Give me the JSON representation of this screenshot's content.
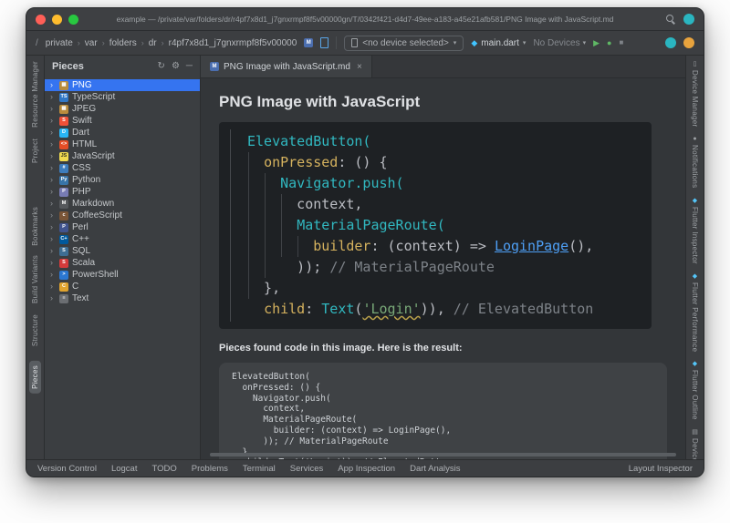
{
  "colors": {
    "plain": "#bcbec4",
    "teal": "#31b8c0",
    "yellow": "#d5b25e",
    "comment": "#7d8288",
    "string": "#79a978",
    "link": "#4e9ff5",
    "accent": "#3574f0"
  },
  "icons": {
    "root_slash": "/",
    "markdown": "M",
    "refresh": "↻",
    "gear": "⚙",
    "hide": "─",
    "close": "×",
    "chevron_down": "▾",
    "play": "▶",
    "debug": "●",
    "stop": "■",
    "dart": "◆"
  },
  "titlebar": {
    "title": "example — /private/var/folders/dr/r4pf7x8d1_j7gnxrmpf8f5v00000gn/T/0342f421-d4d7-49ee-a183-a45e21afb581/PNG Image with JavaScript.md"
  },
  "toolbar": {
    "breadcrumbs": [
      "private",
      "var",
      "folders",
      "dr",
      "r4pf7x8d1_j7gnxrmpf8f5v00000"
    ],
    "device_selector": "<no device selected>",
    "run_config": "main.dart",
    "devices_label": "No Devices"
  },
  "left_stripe": [
    {
      "label": "Resource Manager"
    },
    {
      "label": "Project"
    },
    {
      "label": "Bookmarks"
    },
    {
      "label": "Build Variants"
    },
    {
      "label": "Structure"
    },
    {
      "label": "Pieces",
      "active": true
    }
  ],
  "right_stripe": [
    {
      "label": "Device Manager",
      "icon": "phone-icon",
      "glyph": "▯"
    },
    {
      "label": "Notifications",
      "icon": "bell-icon",
      "glyph": "●"
    },
    {
      "label": "Flutter Inspector",
      "icon": "flutter-icon",
      "glyph": "◆"
    },
    {
      "label": "Flutter Performance",
      "icon": "flutter-icon",
      "glyph": "◆"
    },
    {
      "label": "Flutter Outline",
      "icon": "flutter-icon",
      "glyph": "◆"
    },
    {
      "label": "Device Fi",
      "icon": "folder-icon",
      "glyph": "▤"
    }
  ],
  "pieces_panel": {
    "title": "Pieces",
    "items": [
      {
        "label": "PNG",
        "icon": "image-icon",
        "icon_color": "#b98c3d",
        "glyph": "▦",
        "selected": true
      },
      {
        "label": "TypeScript",
        "icon": "typescript-icon",
        "icon_color": "#3178c6",
        "glyph": "TS"
      },
      {
        "label": "JPEG",
        "icon": "image-icon",
        "icon_color": "#b98c3d",
        "glyph": "▦"
      },
      {
        "label": "Swift",
        "icon": "swift-icon",
        "icon_color": "#f05138",
        "glyph": "S"
      },
      {
        "label": "Dart",
        "icon": "dart-icon",
        "icon_color": "#29b6f6",
        "glyph": "D"
      },
      {
        "label": "HTML",
        "icon": "html-icon",
        "icon_color": "#e44d26",
        "glyph": "<>"
      },
      {
        "label": "JavaScript",
        "icon": "javascript-icon",
        "icon_color": "#f0db4f",
        "glyph": "JS",
        "glyph_color": "#33331f"
      },
      {
        "label": "CSS",
        "icon": "css-icon",
        "icon_color": "#3d7dbd",
        "glyph": "#"
      },
      {
        "label": "Python",
        "icon": "python-icon",
        "icon_color": "#3874a8",
        "glyph": "Py"
      },
      {
        "label": "PHP",
        "icon": "php-icon",
        "icon_color": "#777bb4",
        "glyph": "P"
      },
      {
        "label": "Markdown",
        "icon": "markdown-icon",
        "icon_color": "#55585c",
        "glyph": "M"
      },
      {
        "label": "CoffeeScript",
        "icon": "coffeescript-icon",
        "icon_color": "#7a5537",
        "glyph": "c"
      },
      {
        "label": "Perl",
        "icon": "perl-icon",
        "icon_color": "#41548f",
        "glyph": "P"
      },
      {
        "label": "C++",
        "icon": "cpp-icon",
        "icon_color": "#00599c",
        "glyph": "C+"
      },
      {
        "label": "SQL",
        "icon": "sql-icon",
        "icon_color": "#3e6e93",
        "glyph": "S"
      },
      {
        "label": "Scala",
        "icon": "scala-icon",
        "icon_color": "#d43b3b",
        "glyph": "S"
      },
      {
        "label": "PowerShell",
        "icon": "powershell-icon",
        "icon_color": "#2b77d1",
        "glyph": ">"
      },
      {
        "label": "C",
        "icon": "c-icon",
        "icon_color": "#e0a32e",
        "glyph": "C"
      },
      {
        "label": "Text",
        "icon": "text-icon",
        "icon_color": "#6b6e72",
        "glyph": "≡"
      }
    ]
  },
  "editor": {
    "tab_label": "PNG Image with JavaScript.md",
    "heading": "PNG Image with JavaScript",
    "caption": "Pieces found code in this image. Here is the result:",
    "image_code": [
      [
        {
          "t": "ElevatedButton(",
          "c": "teal"
        }
      ],
      [
        {
          "t": "  "
        },
        {
          "t": "onPressed",
          "c": "yellow"
        },
        {
          "t": ": () {"
        }
      ],
      [
        {
          "t": "    "
        },
        {
          "t": "Navigator.push(",
          "c": "teal"
        }
      ],
      [
        {
          "t": "      context,"
        }
      ],
      [
        {
          "t": "      "
        },
        {
          "t": "MaterialPageRoute(",
          "c": "teal"
        }
      ],
      [
        {
          "t": "        "
        },
        {
          "t": "builder",
          "c": "yellow"
        },
        {
          "t": ": (context) => "
        },
        {
          "t": "LoginPage",
          "c": "link",
          "u": true
        },
        {
          "t": "(),"
        }
      ],
      [
        {
          "t": "      )); "
        },
        {
          "t": "// MaterialPageRoute",
          "c": "comment"
        }
      ],
      [
        {
          "t": "  },"
        }
      ],
      [
        {
          "t": "  "
        },
        {
          "t": "child",
          "c": "yellow"
        },
        {
          "t": ": "
        },
        {
          "t": "Text",
          "c": "teal"
        },
        {
          "t": "("
        },
        {
          "t": "'Login'",
          "c": "string",
          "w": true
        },
        {
          "t": ")), "
        },
        {
          "t": "// ElevatedButton",
          "c": "comment"
        }
      ]
    ],
    "result_code": [
      "ElevatedButton(",
      "  onPressed: () {",
      "    Navigator.push(",
      "      context,",
      "      MaterialPageRoute(",
      "        builder: (context) => LoginPage(),",
      "      )); // MaterialPageRoute",
      "  },",
      "  child: Text('Login')), // ElevatedButton"
    ]
  },
  "status_bar": {
    "left": [
      "Version Control",
      "Logcat",
      "TODO",
      "Problems",
      "Terminal",
      "Services",
      "App Inspection",
      "Dart Analysis"
    ],
    "right": [
      "Layout Inspector"
    ]
  }
}
